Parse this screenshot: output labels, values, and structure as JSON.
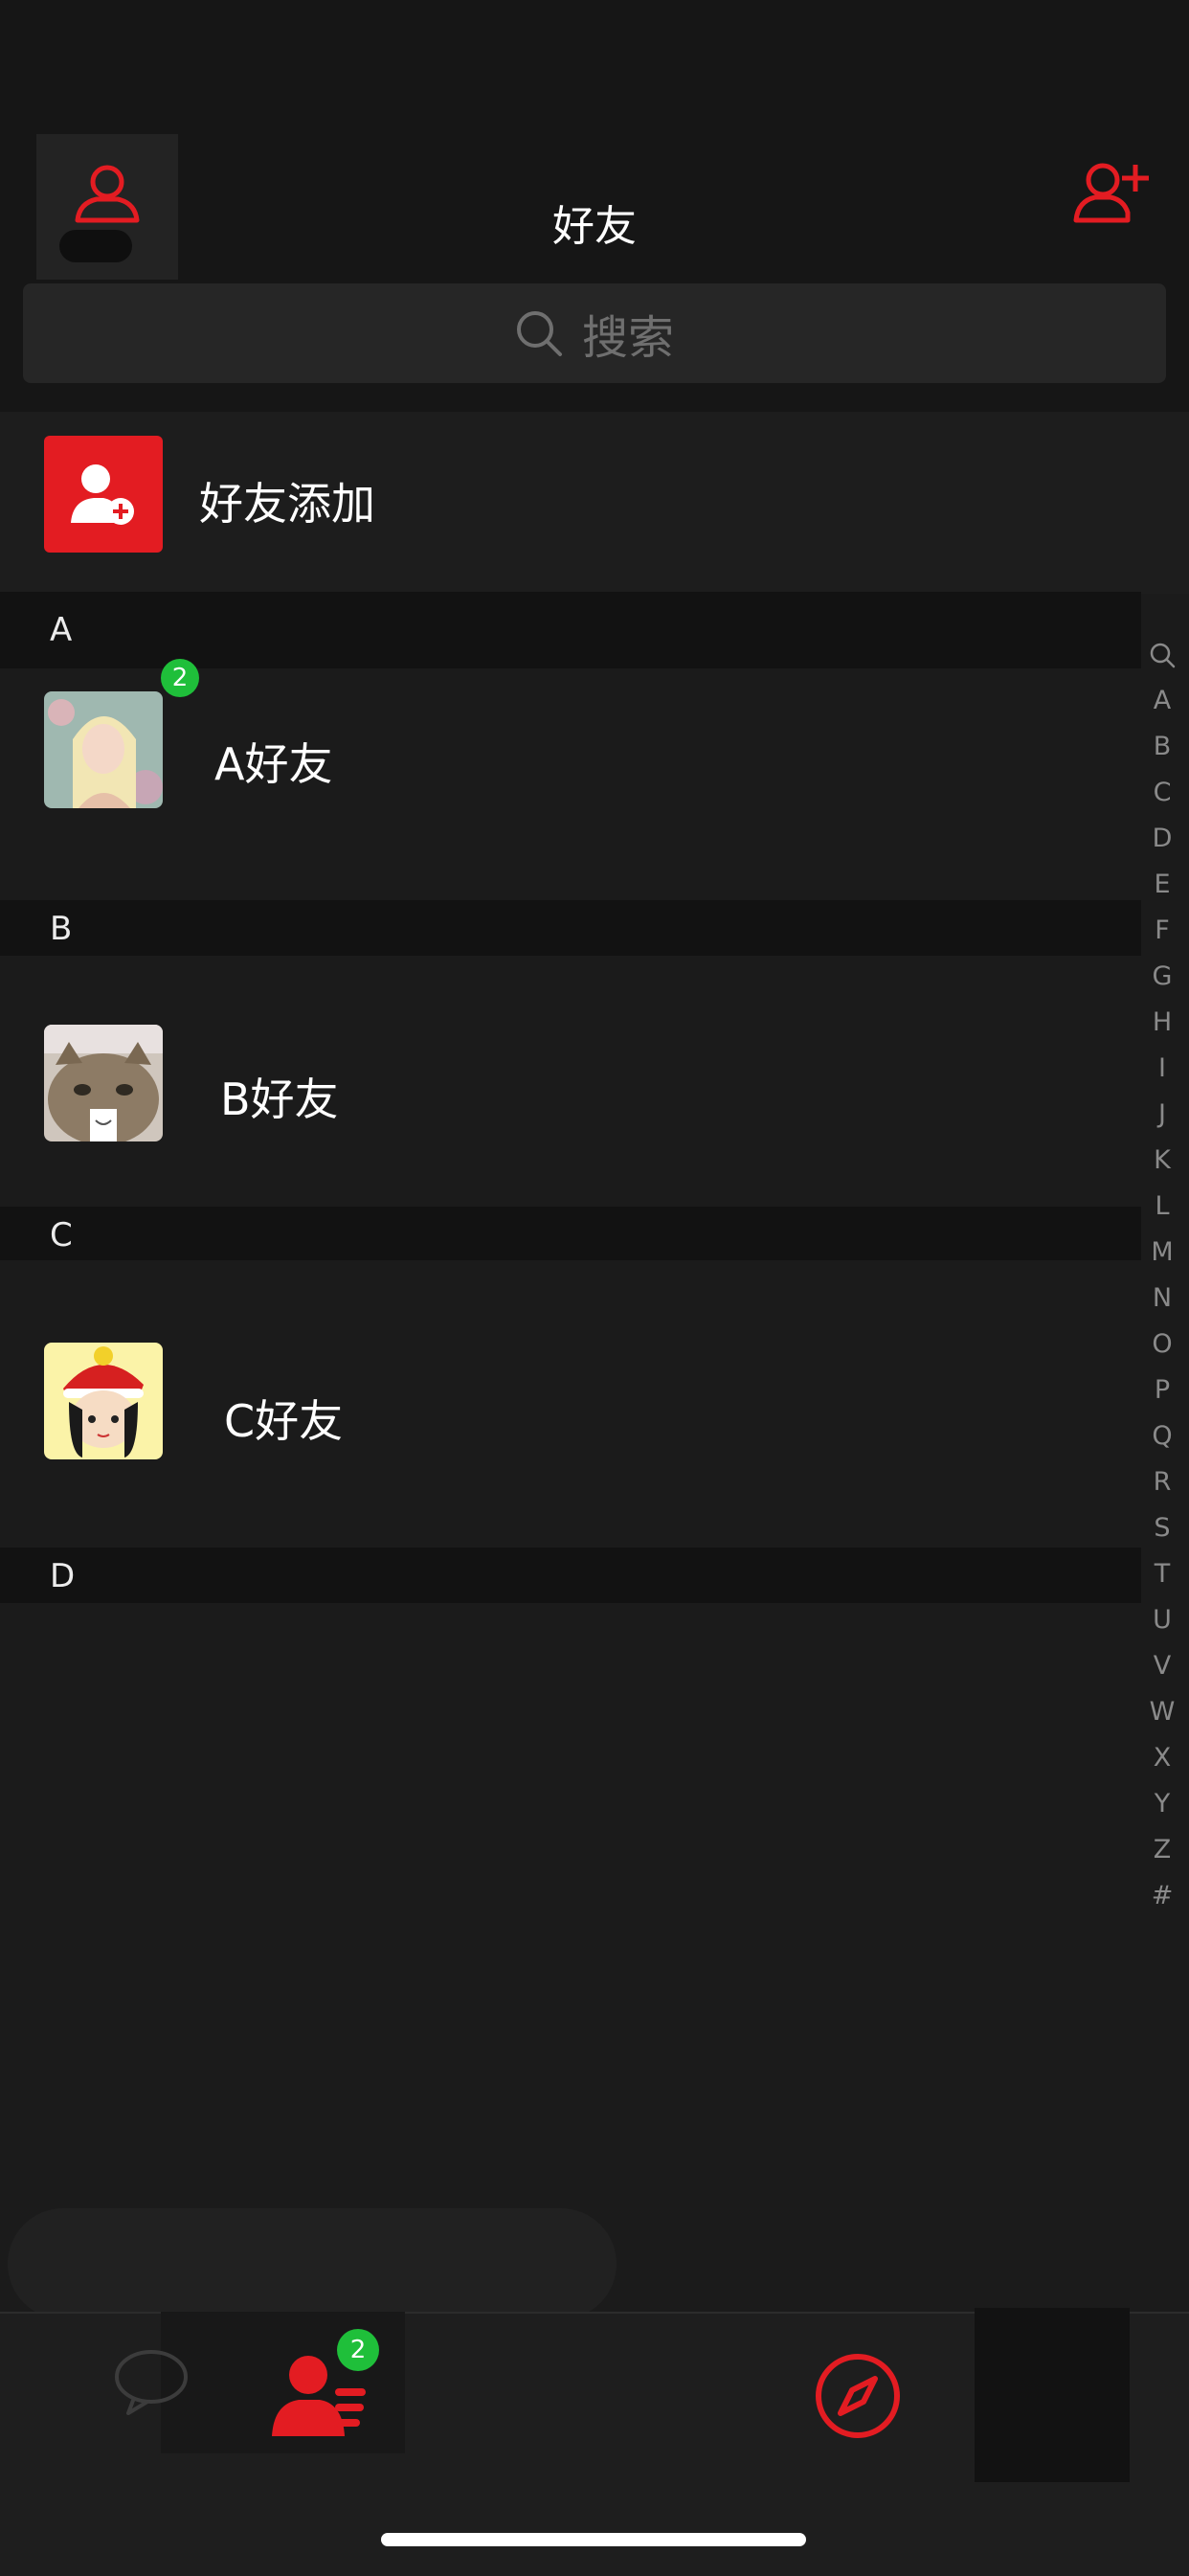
{
  "header": {
    "title": "好友",
    "profile_icon": "person-icon",
    "add_friend_icon": "add-person-icon"
  },
  "search": {
    "placeholder": "搜索",
    "icon": "search-icon"
  },
  "add_entry": {
    "label": "好友添加",
    "icon": "add-person-plus-icon",
    "color": "#e31c22"
  },
  "sections": [
    {
      "letter": "A",
      "friends": [
        {
          "name": "A好友",
          "badge": "2",
          "avatar": "blonde-girl-painting"
        }
      ]
    },
    {
      "letter": "B",
      "friends": [
        {
          "name": "B好友",
          "avatar": "cat-photo"
        }
      ]
    },
    {
      "letter": "C",
      "friends": [
        {
          "name": "C好友",
          "avatar": "santa-hat-cartoon-girl"
        }
      ]
    },
    {
      "letter": "D",
      "friends": []
    }
  ],
  "index_bar": [
    "A",
    "B",
    "C",
    "D",
    "E",
    "F",
    "G",
    "H",
    "I",
    "J",
    "K",
    "L",
    "M",
    "N",
    "O",
    "P",
    "Q",
    "R",
    "S",
    "T",
    "U",
    "V",
    "W",
    "X",
    "Y",
    "Z",
    "#"
  ],
  "tabbar": {
    "chat_icon": "chat-bubble-icon",
    "contacts_icon": "contacts-icon",
    "contacts_badge": "2",
    "discover_icon": "compass-icon",
    "accent": "#e31c22"
  }
}
